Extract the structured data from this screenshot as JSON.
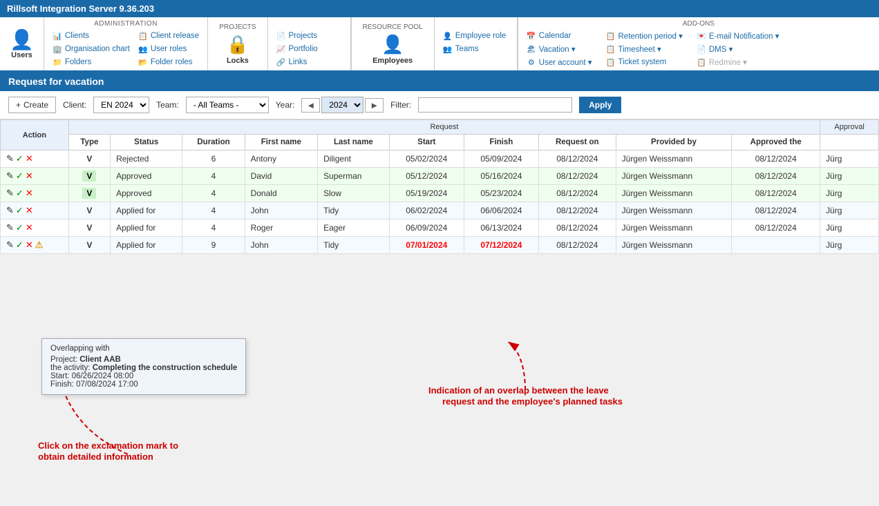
{
  "app": {
    "title": "Rillsoft Integration Server 9.36.203"
  },
  "nav": {
    "administration": {
      "label": "ADMINISTRATION",
      "items_col1": [
        "Clients",
        "Organisation chart",
        "Folders"
      ],
      "items_col2": [
        "Client release",
        "User roles",
        "Folder roles"
      ],
      "users_label": "Users"
    },
    "projects": {
      "label": "PROJECTS",
      "lock_label": "Locks",
      "items": [
        "Projects",
        "Portfolio",
        "Links"
      ]
    },
    "resource_pool": {
      "label": "RESOURCE POOL",
      "employees_label": "Employees",
      "items": [
        "Employee role",
        "Teams"
      ]
    },
    "addons": {
      "label": "ADD-ONS",
      "col1": [
        "Calendar",
        "Vacation ▾",
        "User account ▾"
      ],
      "col2": [
        "Retention period ▾",
        "Timesheet ▾",
        "Ticket system"
      ],
      "col3": [
        "E-mail Notification ▾",
        "DMS ▾",
        "Redmine ▾"
      ]
    }
  },
  "page": {
    "header": "Request for vacation"
  },
  "toolbar": {
    "create_label": "+ Create",
    "client_label": "Client:",
    "client_value": "EN 2024",
    "team_label": "Team:",
    "team_value": "- All Teams -",
    "year_label": "Year:",
    "year_value": "2024",
    "filter_label": "Filter:",
    "filter_placeholder": "",
    "apply_label": "Apply"
  },
  "table": {
    "group_headers": {
      "request_label": "Request",
      "approval_label": "Approval"
    },
    "columns": [
      "Action",
      "Type",
      "Status",
      "Duration",
      "First name",
      "Last name",
      "Start",
      "Finish",
      "Request on",
      "Provided by",
      "Approved the"
    ],
    "rows": [
      {
        "type": "V",
        "type_badge": false,
        "status": "Rejected",
        "duration": "6",
        "first_name": "Antony",
        "last_name": "Diligent",
        "start": "05/02/2024",
        "finish": "05/09/2024",
        "request_on": "08/12/2024",
        "provided_by": "Jürgen Weissmann",
        "approved_the": "08/12/2024",
        "approved_by": "Jürg",
        "start_red": false,
        "finish_red": false,
        "row_class": ""
      },
      {
        "type": "V",
        "type_badge": true,
        "status": "Approved",
        "duration": "4",
        "first_name": "David",
        "last_name": "Superman",
        "start": "05/12/2024",
        "finish": "05/16/2024",
        "request_on": "08/12/2024",
        "provided_by": "Jürgen Weissmann",
        "approved_the": "08/12/2024",
        "approved_by": "Jürg",
        "start_red": false,
        "finish_red": false,
        "row_class": "row-highlight-green"
      },
      {
        "type": "V",
        "type_badge": true,
        "status": "Approved",
        "duration": "4",
        "first_name": "Donald",
        "last_name": "Slow",
        "start": "05/19/2024",
        "finish": "05/23/2024",
        "request_on": "08/12/2024",
        "provided_by": "Jürgen Weissmann",
        "approved_the": "08/12/2024",
        "approved_by": "Jürg",
        "start_red": false,
        "finish_red": false,
        "row_class": "row-highlight-green"
      },
      {
        "type": "V",
        "type_badge": false,
        "status": "Applied for",
        "duration": "4",
        "first_name": "John",
        "last_name": "Tidy",
        "start": "06/02/2024",
        "finish": "06/06/2024",
        "request_on": "08/12/2024",
        "provided_by": "Jürgen Weissmann",
        "approved_the": "08/12/2024",
        "approved_by": "Jürg",
        "start_red": false,
        "finish_red": false,
        "row_class": "row-highlight-light"
      },
      {
        "type": "V",
        "type_badge": false,
        "status": "Applied for",
        "duration": "4",
        "first_name": "Roger",
        "last_name": "Eager",
        "start": "06/09/2024",
        "finish": "06/13/2024",
        "request_on": "08/12/2024",
        "provided_by": "Jürgen Weissmann",
        "approved_the": "08/12/2024",
        "approved_by": "Jürg",
        "start_red": false,
        "finish_red": false,
        "row_class": ""
      },
      {
        "type": "V",
        "type_badge": false,
        "status": "Applied for",
        "duration": "9",
        "first_name": "John",
        "last_name": "Tidy",
        "start": "07/01/2024",
        "finish": "07/12/2024",
        "request_on": "08/12/2024",
        "provided_by": "Jürgen Weissmann",
        "approved_the": "",
        "approved_by": "Jürg",
        "start_red": true,
        "finish_red": true,
        "row_class": "row-highlight-light",
        "has_warning": true
      }
    ]
  },
  "tooltip": {
    "title": "Overlapping with",
    "project_label": "Project: ",
    "project_name": "Client AAB",
    "activity_label": "the activity: ",
    "activity_name": "Completing the construction schedule",
    "start_label": "Start: ",
    "start_value": "06/26/2024 08:00",
    "finish_label": "Finish: ",
    "finish_value": "07/08/2024 17:00"
  },
  "annotations": {
    "click_text": "Click on the exclamation mark to\nobtain detailed information",
    "overlap_text": "Indication of an overlap between the leave\nrequest and the employee's planned tasks"
  }
}
